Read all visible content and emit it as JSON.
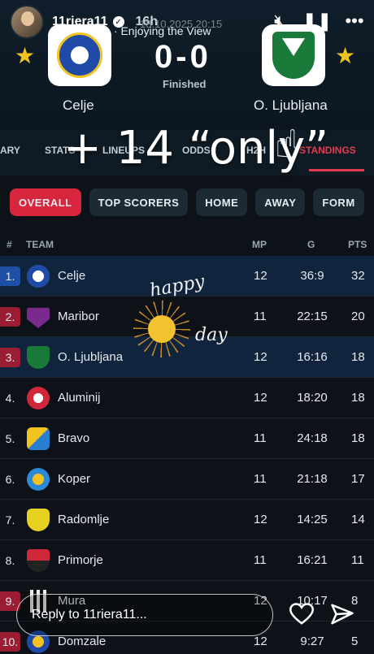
{
  "story": {
    "username": "11riera11",
    "time_ago": "16h",
    "music": "Harpoon · Enjoying the View",
    "date_overlay": "18.10.2025 20:15"
  },
  "match": {
    "home_team": "Celje",
    "away_team": "O. Ljubljana",
    "score": "0-0",
    "status": "Finished"
  },
  "tabs": [
    "ARY",
    "STATS",
    "LINEUPS",
    "ODDS",
    "H2H",
    "STANDINGS"
  ],
  "active_tab": "STANDINGS",
  "overlay_text": "+ 14 “only”",
  "filters": [
    "OVERALL",
    "TOP SCORERS",
    "HOME",
    "AWAY",
    "FORM"
  ],
  "table": {
    "headers": {
      "rank": "#",
      "team": "TEAM",
      "mp": "MP",
      "g": "G",
      "pts": "PTS"
    },
    "rows": [
      {
        "rank": "1.",
        "team": "Celje",
        "mp": "12",
        "g": "36:9",
        "pts": "32"
      },
      {
        "rank": "2.",
        "team": "Maribor",
        "mp": "11",
        "g": "22:15",
        "pts": "20"
      },
      {
        "rank": "3.",
        "team": "O. Ljubljana",
        "mp": "12",
        "g": "16:16",
        "pts": "18"
      },
      {
        "rank": "4.",
        "team": "Aluminij",
        "mp": "12",
        "g": "18:20",
        "pts": "18"
      },
      {
        "rank": "5.",
        "team": "Bravo",
        "mp": "11",
        "g": "24:18",
        "pts": "18"
      },
      {
        "rank": "6.",
        "team": "Koper",
        "mp": "11",
        "g": "21:18",
        "pts": "17"
      },
      {
        "rank": "7.",
        "team": "Radomlje",
        "mp": "12",
        "g": "14:25",
        "pts": "14"
      },
      {
        "rank": "8.",
        "team": "Primorje",
        "mp": "11",
        "g": "16:21",
        "pts": "11"
      },
      {
        "rank": "9.",
        "team": "Mura",
        "mp": "12",
        "g": "10:17",
        "pts": "8"
      },
      {
        "rank": "10.",
        "team": "Domzale",
        "mp": "12",
        "g": "9:27",
        "pts": "5"
      }
    ]
  },
  "sticker": {
    "line1": "happy",
    "line2": "day"
  },
  "reply": {
    "placeholder": "Reply to 11riera11..."
  },
  "colors": {
    "accent": "#d8263f",
    "ucl_blue": "#1d4fa5",
    "relegation_red": "#9b1d34",
    "star": "#f0c420"
  }
}
